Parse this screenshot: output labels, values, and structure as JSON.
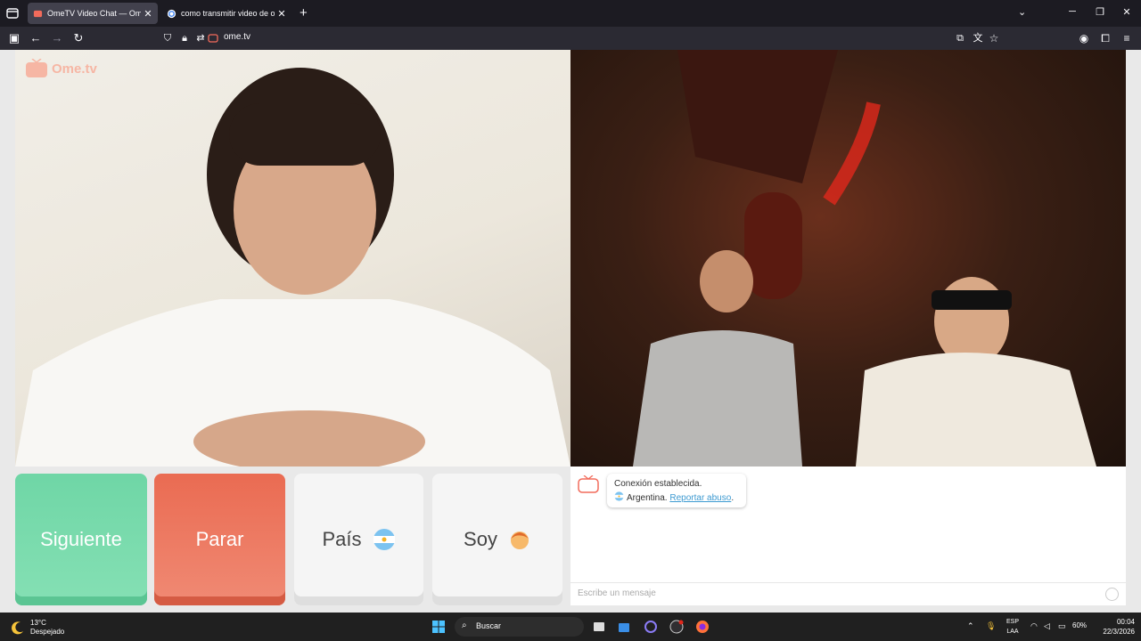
{
  "browser": {
    "tabs": [
      {
        "title": "OmeTV Video Chat — Ome",
        "active": true
      },
      {
        "title": "como transmitir video de obs a",
        "active": false
      }
    ],
    "new_tab": "+",
    "url": "ome.tv"
  },
  "page": {
    "logo_text": "Ome.tv",
    "buttons": {
      "next": "Siguiente",
      "stop": "Parar",
      "country": "País",
      "gender": "Soy"
    },
    "chat": {
      "line1": "Conexión establecida.",
      "country": "Argentina.",
      "report_link": "Reportar abuso",
      "period": ".",
      "input_placeholder": "Escribe un mensaje"
    }
  },
  "taskbar": {
    "temp": "13°C",
    "condition": "Despejado",
    "search": "Buscar",
    "lang_top": "ESP",
    "lang_bottom": "LAA",
    "battery": "60%",
    "time": "00:04",
    "date": "22/3/2026"
  },
  "colors": {
    "next": "#6fd6a6",
    "stop": "#ea6b52",
    "link": "#3d9ad1"
  }
}
